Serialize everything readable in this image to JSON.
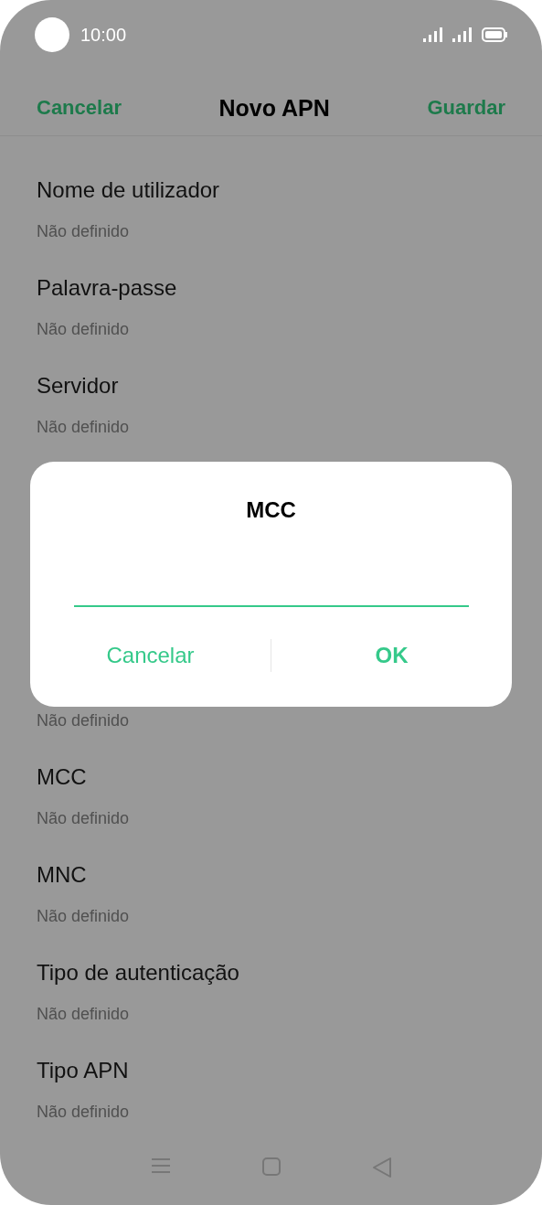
{
  "status_bar": {
    "time": "10:00"
  },
  "header": {
    "cancel": "Cancelar",
    "title": "Novo APN",
    "save": "Guardar"
  },
  "items_above": [
    {
      "title": "Nome de utilizador",
      "subtitle": "Não definido"
    },
    {
      "title": "Palavra-passe",
      "subtitle": "Não definido"
    },
    {
      "title": "Servidor",
      "subtitle": "Não definido"
    }
  ],
  "items_below": [
    {
      "subtitle": "Não definido"
    },
    {
      "title": "MCC",
      "subtitle": "Não definido"
    },
    {
      "title": "MNC",
      "subtitle": "Não definido"
    },
    {
      "title": "Tipo de autenticação",
      "subtitle": "Não definido"
    },
    {
      "title": "Tipo APN",
      "subtitle": "Não definido"
    }
  ],
  "dialog": {
    "title": "MCC",
    "buttons": [
      {
        "label": "Cancelar",
        "kind": "secondary"
      },
      {
        "label": "OK",
        "kind": "primary"
      }
    ]
  }
}
